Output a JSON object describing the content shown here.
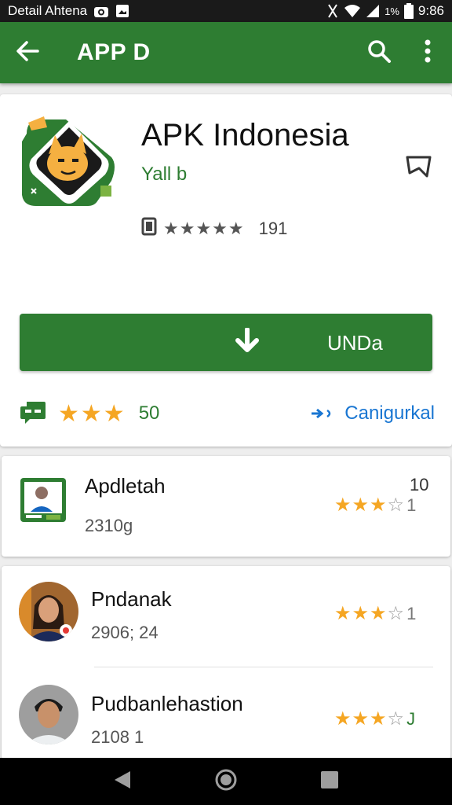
{
  "status_bar": {
    "left_text": "Detail Ahtena",
    "time": "9:86",
    "battery": "1%",
    "icons": [
      "camera-icon",
      "image-icon",
      "mute-icon",
      "wifi-icon",
      "signal-icon",
      "battery-icon"
    ]
  },
  "app_bar": {
    "title": "APP D",
    "icons": [
      "back-arrow-icon",
      "search-icon",
      "more-vert-icon"
    ]
  },
  "app": {
    "name": "APK Indonesia",
    "developer": "Yall b",
    "rating_stars": "★★★★★",
    "rating_count": "191",
    "install_label": "UNDa",
    "review_stars": "★★★",
    "review_count": "50",
    "link_label": "Canigurkal",
    "accent": "#2e7d32",
    "link_color": "#1976d2",
    "star_color": "#f5a623"
  },
  "list": [
    {
      "title": "Apdletah",
      "sub": "2310g",
      "count_top": "10",
      "stars": "★★★",
      "empty": "☆",
      "count": "1"
    },
    {
      "title": "Pndanak",
      "sub": "2906; 24",
      "stars": "★★★",
      "empty": "☆",
      "count": "1"
    },
    {
      "title": "Pudbanlehastion",
      "sub": "2108 1",
      "stars": "★★★",
      "empty": "☆",
      "count": "J"
    }
  ]
}
